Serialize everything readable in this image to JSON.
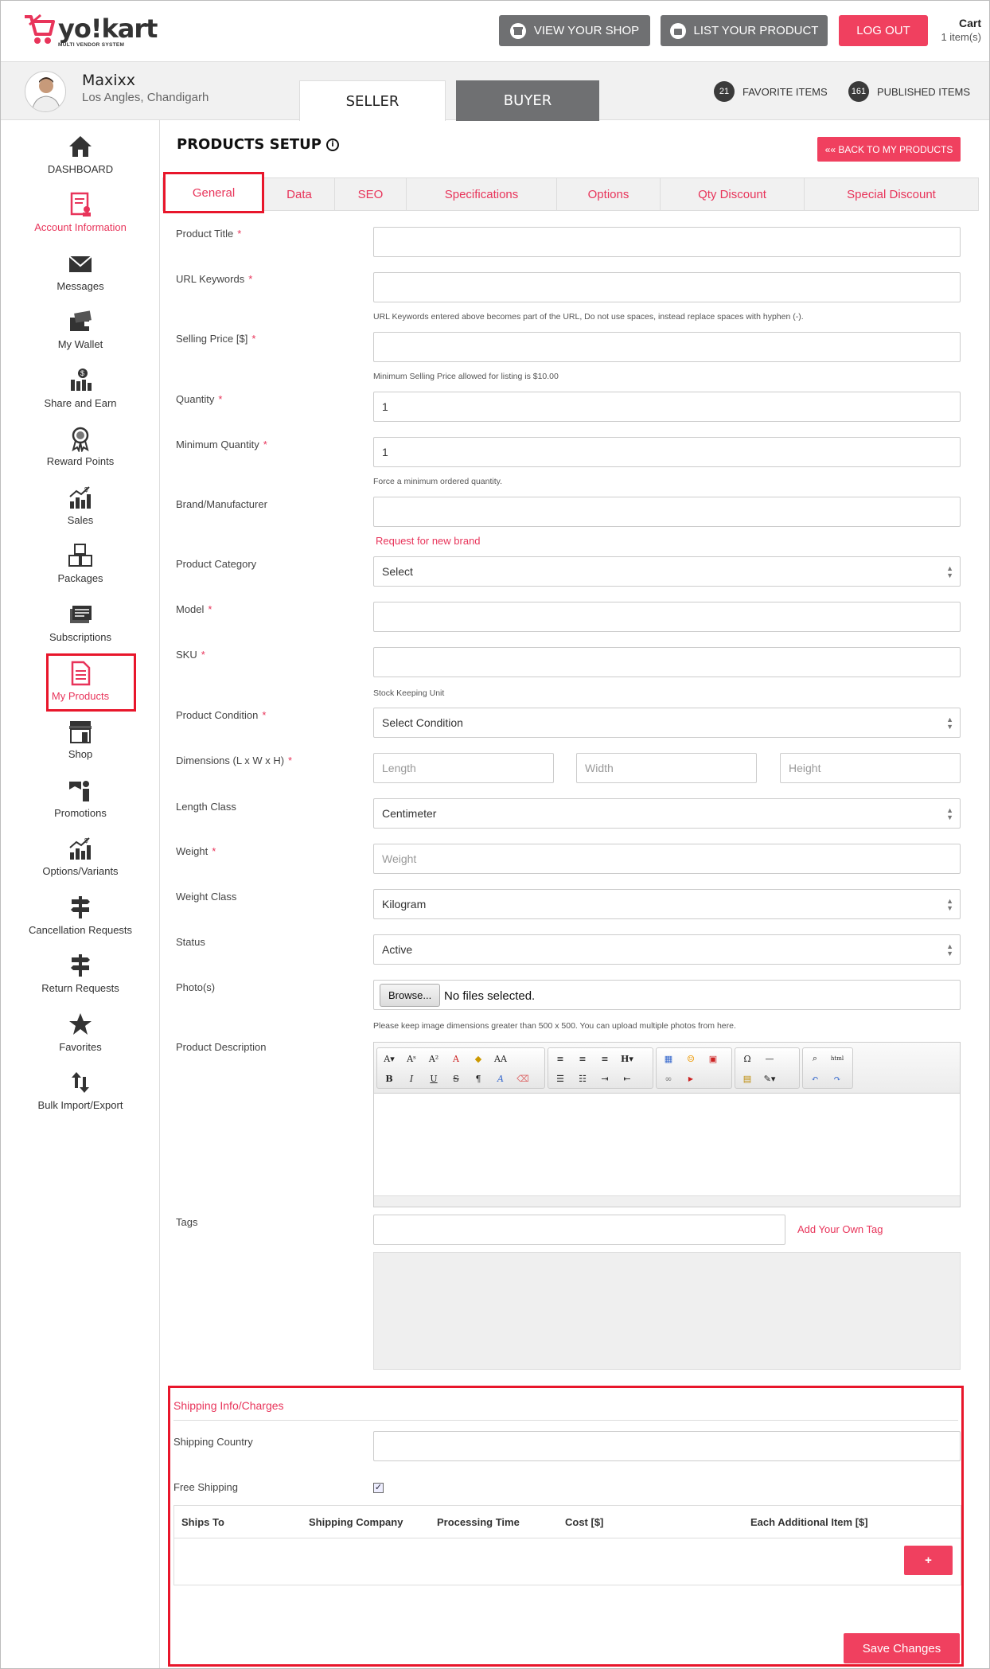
{
  "header": {
    "logo_text": "yo!kart",
    "logo_tagline": "MULTI VENDOR SYSTEM",
    "view_shop": "VIEW YOUR SHOP",
    "list_product": "LIST YOUR PRODUCT",
    "logout": "LOG OUT",
    "cart_label": "Cart",
    "cart_count": "1 item(s)"
  },
  "profile": {
    "name": "Maxixx",
    "location": "Los Angles, Chandigarh",
    "tab_seller": "SELLER",
    "tab_buyer": "BUYER",
    "favorite_count": "21",
    "favorite_label": "FAVORITE ITEMS",
    "published_count": "161",
    "published_label": "PUBLISHED ITEMS"
  },
  "sidebar": {
    "items": [
      {
        "label": "DASHBOARD",
        "icon": "home-icon"
      },
      {
        "label": "Account Information",
        "icon": "account-info-icon"
      },
      {
        "label": "Messages",
        "icon": "envelope-icon"
      },
      {
        "label": "My Wallet",
        "icon": "wallet-icon"
      },
      {
        "label": "Share and Earn",
        "icon": "share-earn-icon"
      },
      {
        "label": "Reward Points",
        "icon": "award-icon"
      },
      {
        "label": "Sales",
        "icon": "sales-chart-icon"
      },
      {
        "label": "Packages",
        "icon": "packages-icon"
      },
      {
        "label": "Subscriptions",
        "icon": "subscriptions-icon"
      },
      {
        "label": "My Products",
        "icon": "document-icon"
      },
      {
        "label": "Shop",
        "icon": "shop-icon"
      },
      {
        "label": "Promotions",
        "icon": "promotions-icon"
      },
      {
        "label": "Options/Variants",
        "icon": "options-chart-icon"
      },
      {
        "label": "Cancellation Requests",
        "icon": "signpost-icon"
      },
      {
        "label": "Return Requests",
        "icon": "signpost-icon"
      },
      {
        "label": "Favorites",
        "icon": "star-icon"
      },
      {
        "label": "Bulk Import/Export",
        "icon": "import-export-icon"
      }
    ]
  },
  "main": {
    "title": "PRODUCTS SETUP",
    "back_button": "«« BACK TO MY PRODUCTS",
    "tabs": [
      "General",
      "Data",
      "SEO",
      "Specifications",
      "Options",
      "Qty Discount",
      "Special Discount"
    ],
    "active_tab": "General"
  },
  "form": {
    "product_title": {
      "label": "Product Title",
      "value": ""
    },
    "url_keywords": {
      "label": "URL Keywords",
      "value": "",
      "hint": "URL Keywords entered above becomes part of the URL, Do not use spaces, instead replace spaces with hyphen (-)."
    },
    "selling_price": {
      "label": "Selling Price [$]",
      "value": "",
      "hint": "Minimum Selling Price allowed for listing is $10.00"
    },
    "quantity": {
      "label": "Quantity",
      "value": "1"
    },
    "min_quantity": {
      "label": "Minimum Quantity",
      "value": "1",
      "hint": "Force a minimum ordered quantity."
    },
    "brand": {
      "label": "Brand/Manufacturer",
      "value": "",
      "link": "Request for new brand"
    },
    "category": {
      "label": "Product Category",
      "value": "Select"
    },
    "model": {
      "label": "Model",
      "value": ""
    },
    "sku": {
      "label": "SKU",
      "value": "",
      "hint": "Stock Keeping Unit"
    },
    "condition": {
      "label": "Product Condition",
      "value": "Select Condition"
    },
    "dimensions": {
      "label": "Dimensions (L x W x H)",
      "length_ph": "Length",
      "width_ph": "Width",
      "height_ph": "Height"
    },
    "length_class": {
      "label": "Length Class",
      "value": "Centimeter"
    },
    "weight": {
      "label": "Weight",
      "placeholder": "Weight"
    },
    "weight_class": {
      "label": "Weight Class",
      "value": "Kilogram"
    },
    "status": {
      "label": "Status",
      "value": "Active"
    },
    "photos": {
      "label": "Photo(s)",
      "browse": "Browse...",
      "file_text": "No files selected.",
      "hint": "Please keep image dimensions greater than 500 x 500. You can upload multiple photos from here."
    },
    "description": {
      "label": "Product Description"
    },
    "tags": {
      "label": "Tags",
      "value": "",
      "link": "Add Your Own Tag"
    }
  },
  "shipping": {
    "title": "Shipping Info/Charges",
    "country_label": "Shipping Country",
    "free_label": "Free Shipping",
    "free_checked": true,
    "columns": [
      "Ships To",
      "Shipping Company",
      "Processing Time",
      "Cost [$]",
      "Each Additional Item [$]"
    ],
    "add_button": "+",
    "save_button": "Save Changes"
  },
  "colors": {
    "accent": "#f0405f",
    "gray_button": "#6f7072",
    "highlight": "#e8162b"
  }
}
